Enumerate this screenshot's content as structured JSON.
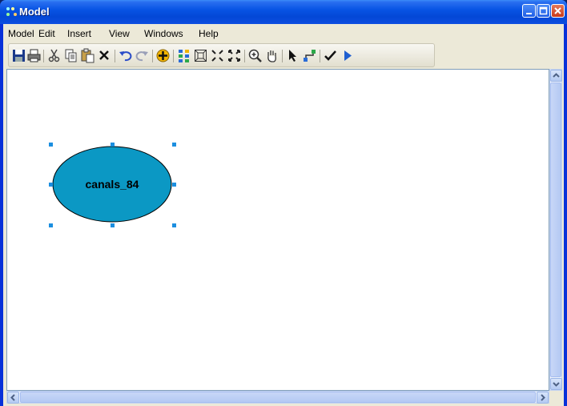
{
  "window": {
    "title": "Model"
  },
  "menu": {
    "items": [
      "Model",
      "Edit",
      "Insert",
      "View",
      "Windows",
      "Help"
    ]
  },
  "toolbar": {
    "tools": [
      "save-icon",
      "print-icon",
      "cut-icon",
      "copy-icon",
      "paste-icon",
      "delete-icon",
      "undo-icon",
      "redo-icon",
      "add-data-icon",
      "auto-layout-icon",
      "full-extent-icon",
      "zoom-in-fixed-icon",
      "zoom-out-fixed-icon",
      "zoom-icon",
      "pan-icon",
      "select-icon",
      "connect-icon",
      "validate-icon",
      "run-icon"
    ]
  },
  "model": {
    "node": {
      "label": "canals_84",
      "fill": "#0b98c4",
      "selected": true
    }
  },
  "colors": {
    "titlebar": "#0854e4",
    "selection_handle": "#1c8fe0"
  }
}
